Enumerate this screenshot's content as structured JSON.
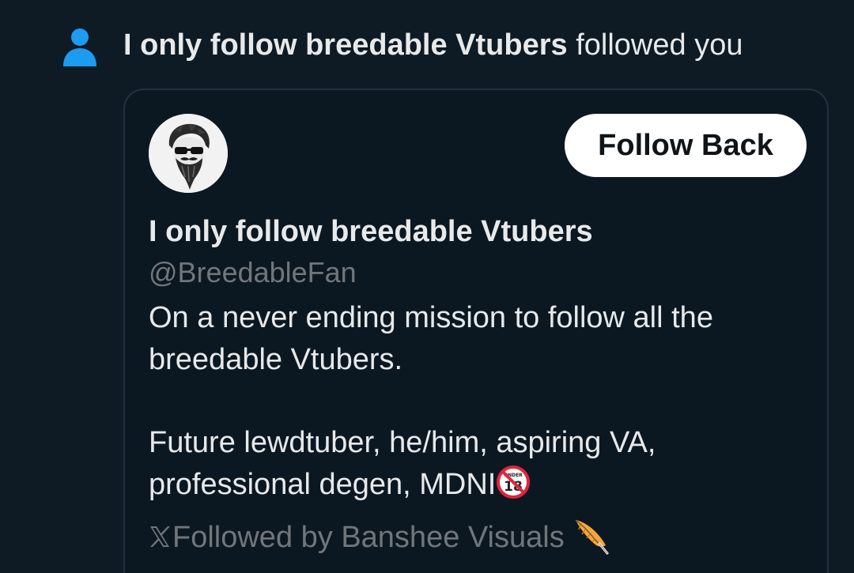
{
  "notification": {
    "icon": "person-icon",
    "actor_name": "I only follow breedable Vtubers",
    "action_text": "followed you"
  },
  "profile_card": {
    "avatar_icon": "bearded-man-sunglasses-avatar",
    "follow_button_label": "Follow Back",
    "display_name": "I only follow breedable Vtubers",
    "handle": "@BreedableFan",
    "bio_line1": "On a never ending mission to follow all the\nbreedable Vtubers.",
    "bio_line2": "Future lewdtuber, he/him, aspiring VA,\nprofessional degen, MDNI",
    "bio_emoji": "no-one-under-eighteen-icon",
    "followed_by_text": "Followed by Banshee Visuals",
    "followed_by_icon": "x-logo-icon",
    "followed_by_emoji": "feather-icon"
  },
  "colors": {
    "background": "#0e1a24",
    "primary_text": "#e7e9ea",
    "secondary_text": "#71767b",
    "accent": "#1d9bf0",
    "card_border": "#24313d",
    "button_bg": "#ffffff"
  }
}
